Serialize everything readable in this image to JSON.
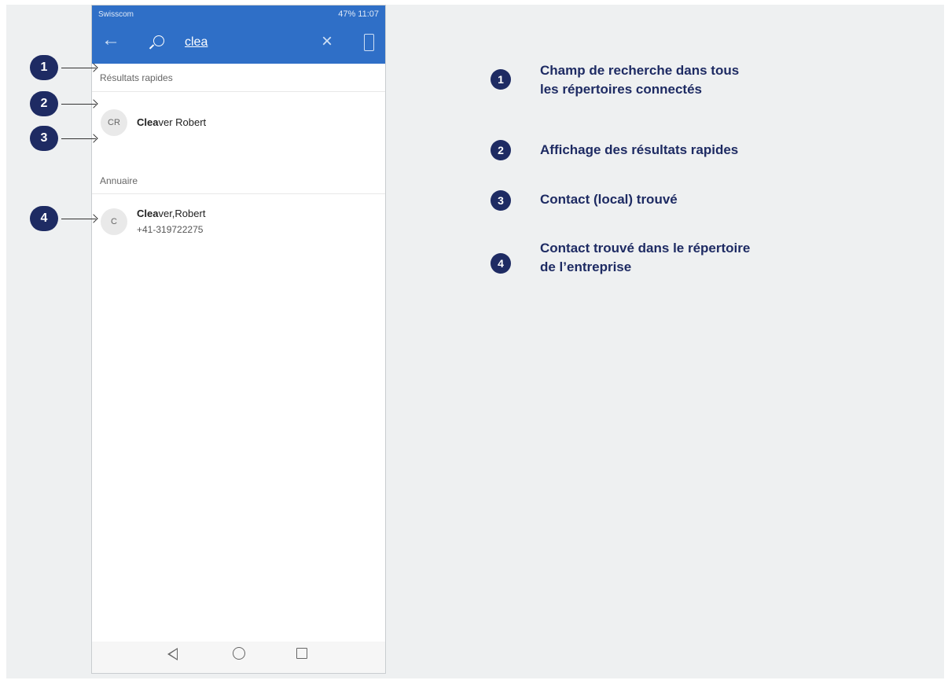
{
  "phone": {
    "status_bar": {
      "carrier": "Swisscom",
      "right": "47% 11:07"
    },
    "search": {
      "query": "clea"
    },
    "sections": {
      "quick_results": "Résultats rapides",
      "directory": "Annuaire"
    },
    "quick_result": {
      "initials": "CR",
      "name_match": "Clea",
      "name_rest": "ver Robert"
    },
    "directory_result": {
      "initials": "C",
      "name_match": "Clea",
      "name_rest": "ver,Robert",
      "phone": "+41-319722275"
    }
  },
  "callouts": [
    "1",
    "2",
    "3",
    "4"
  ],
  "legend": [
    {
      "number": "1",
      "line1": "Champ de recherche dans tous",
      "line2": "les répertoires connectés"
    },
    {
      "number": "2",
      "line1": "Affichage des résultats rapides",
      "line2": ""
    },
    {
      "number": "3",
      "line1": "Contact (local) trouvé",
      "line2": ""
    },
    {
      "number": "4",
      "line1": "Contact trouvé dans le répertoire",
      "line2": "de l’entreprise"
    }
  ],
  "colors": {
    "app_bar": "#2f6fc7",
    "badge": "#1e2b63",
    "background": "#eef0f1"
  }
}
